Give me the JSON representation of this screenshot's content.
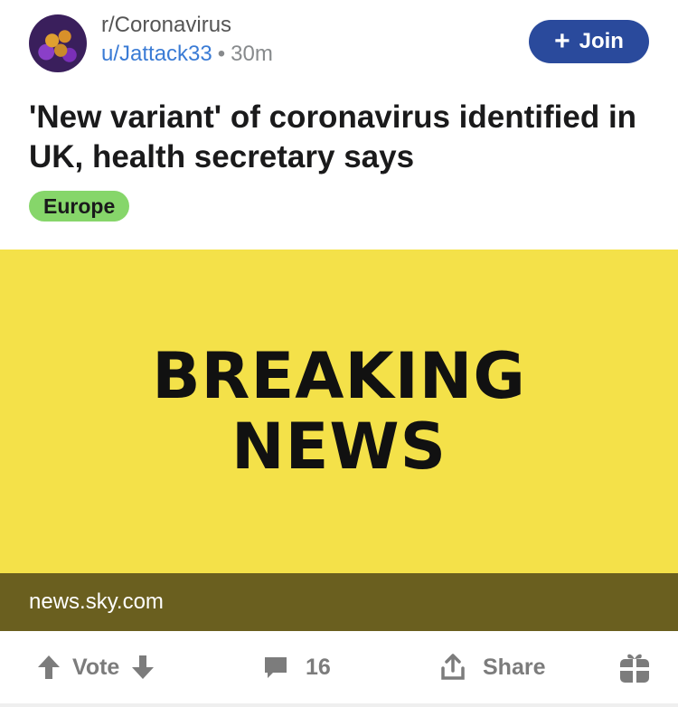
{
  "post": {
    "subreddit": "r/Coronavirus",
    "author": "u/Jattack33",
    "separator": "•",
    "age": "30m",
    "join_label": "Join",
    "title": "'New variant' of coronavirus identified in UK, health secretary says",
    "flair": "Europe",
    "media_lines": [
      "BREAKING",
      "NEWS"
    ],
    "link_domain": "news.sky.com"
  },
  "actions": {
    "vote_label": "Vote",
    "comment_count": "16",
    "share_label": "Share"
  },
  "colors": {
    "join_bg": "#2a4a9c",
    "flair_bg": "#86d66a",
    "media_bg": "#f4e149",
    "link_bar_bg": "#6a5f1f",
    "author_link": "#3a7bd5"
  },
  "icons": {
    "upvote": "arrow-up-icon",
    "downvote": "arrow-down-icon",
    "comment": "comment-bubble-icon",
    "share": "share-upload-icon",
    "award": "gift-award-icon"
  }
}
